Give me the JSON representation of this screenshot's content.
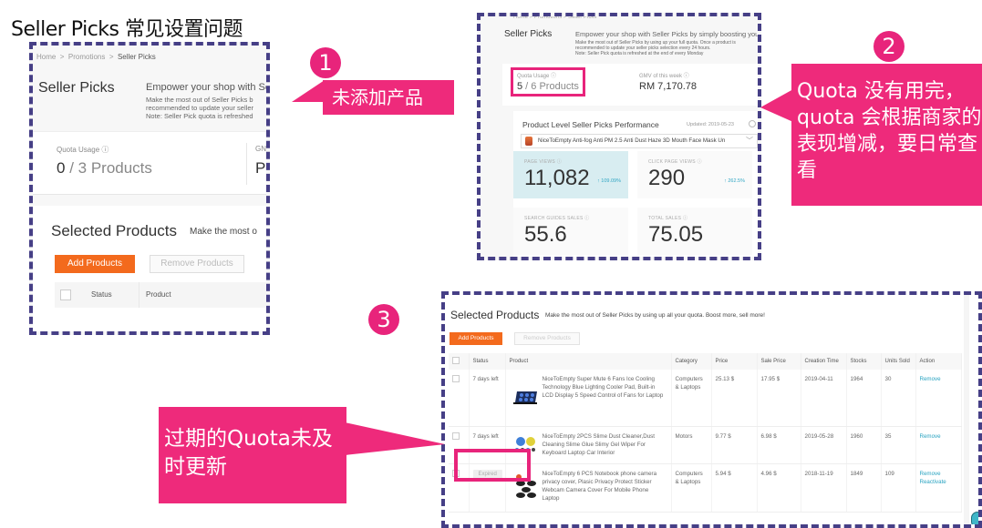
{
  "page_title": "Seller Picks 常见设置问题",
  "panel1": {
    "breadcrumb": [
      "Home",
      "Promotions",
      "Seller Picks"
    ],
    "breadcrumb_sep": ">",
    "heading": "Seller Picks",
    "empower": "Empower your shop with Se",
    "desc_lines": [
      "Make the most out of Seller Picks b",
      "recommended to update your seller",
      "Note: Seller Pick quota is refreshed"
    ],
    "quota_label": "Quota Usage ⓘ",
    "quota_used": "0",
    "quota_total": " / 3 Products",
    "gmv_label": "GN",
    "gmv_value": "P",
    "selected_title": "Selected Products",
    "selected_sub": "Make the most o",
    "add_button": "Add Products",
    "remove_button": "Remove Products",
    "col_status": "Status",
    "col_product": "Product"
  },
  "panel2": {
    "breadcrumb": "Home > Promotions > Seller Picks",
    "heading": "Seller Picks",
    "empower": "Empower your shop with Seller Picks by simply boosting your p",
    "desc_lines": [
      "Make the most out of Seller Picks by using up your full quota. Once a product is",
      "recommended to update your seller picks selection every 24 hours.",
      "Note: Seller Pick quota is refreshed at the end of every Monday"
    ],
    "quota_label": "Quota Usage ⓘ",
    "quota_used": "5",
    "quota_total": " / 6 Products",
    "gmv_label": "GMV of this week ⓘ",
    "gmv_value": "RM 7,170.78",
    "perf_title": "Product Level Seller Picks Performance",
    "updated": "Updated: 2019-05-23",
    "product_select": "NiceToEmpty Anti-fog Anti PM 2.5 Anti Dust Haze 3D Mouth Face Mask Un",
    "metrics": [
      {
        "label": "PAGE VIEWS ⓘ",
        "value": "11,082",
        "change": "↑ 109.09%"
      },
      {
        "label": "CLICK PAGE VIEWS ⓘ",
        "value": "290",
        "change": "↑ 262.5%"
      },
      {
        "label": "SEARCH GUIDES SALES ⓘ",
        "value": "55.6",
        "change": ""
      },
      {
        "label": "TOTAL SALES ⓘ",
        "value": "75.05",
        "change": ""
      }
    ]
  },
  "panel3": {
    "title": "Selected Products",
    "subtitle": "Make the most out of Seller Picks by using up all your quota. Boost more, sell more!",
    "add_button": "Add Products",
    "remove_button": "Remove Products",
    "columns": [
      "Status",
      "Product",
      "Category",
      "Price",
      "Sale Price",
      "Creation Time",
      "Stocks",
      "Units Sold",
      "Action"
    ],
    "rows": [
      {
        "status": "7 days left",
        "product": "NiceToEmpty Super Mute 6 Fans Ice Cooling Technology Blue Lighting Cooler Pad, Built-in LCD Display 5 Speed Control of Fans for Laptop",
        "category": "Computers & Laptops",
        "price": "25.13 $",
        "sale_price": "17.95 $",
        "created": "2019-04-11",
        "stocks": "1964",
        "sold": "30",
        "actions": [
          "Remove"
        ]
      },
      {
        "status": "7 days left",
        "product": "NiceToEmpty 2PCS Slime Dust Cleaner,Dust Cleaning Slime Glue Slimy Gel Wiper For Keyboard Laptop Car Interior",
        "category": "Motors",
        "price": "9.77 $",
        "sale_price": "6.98 $",
        "created": "2019-05-28",
        "stocks": "1960",
        "sold": "35",
        "actions": [
          "Remove"
        ]
      },
      {
        "status": "Expired",
        "product": "NiceToEmpty 6 PCS Notebook phone camera privacy cover, Plasic Privacy Protect Sticker Webcam Camera Cover For Mobile Phone Laptop",
        "category": "Computers & Laptops",
        "price": "5.94 $",
        "sale_price": "4.96 $",
        "created": "2018-11-19",
        "stocks": "1849",
        "sold": "109",
        "actions": [
          "Remove",
          "Reactivate"
        ]
      }
    ]
  },
  "callouts": [
    {
      "number": "1",
      "text": "未添加产品"
    },
    {
      "number": "2",
      "text": "Quota 没有用完，quota 会根据商家的表现增减，要日常查看"
    },
    {
      "number": "3",
      "text": "过期的Quota未及时更新"
    }
  ],
  "colors": {
    "accent_pink": "#ee2a7b",
    "frame_purple": "#463f86",
    "orange_button": "#f36a1d",
    "link_teal": "#29a3c1"
  }
}
